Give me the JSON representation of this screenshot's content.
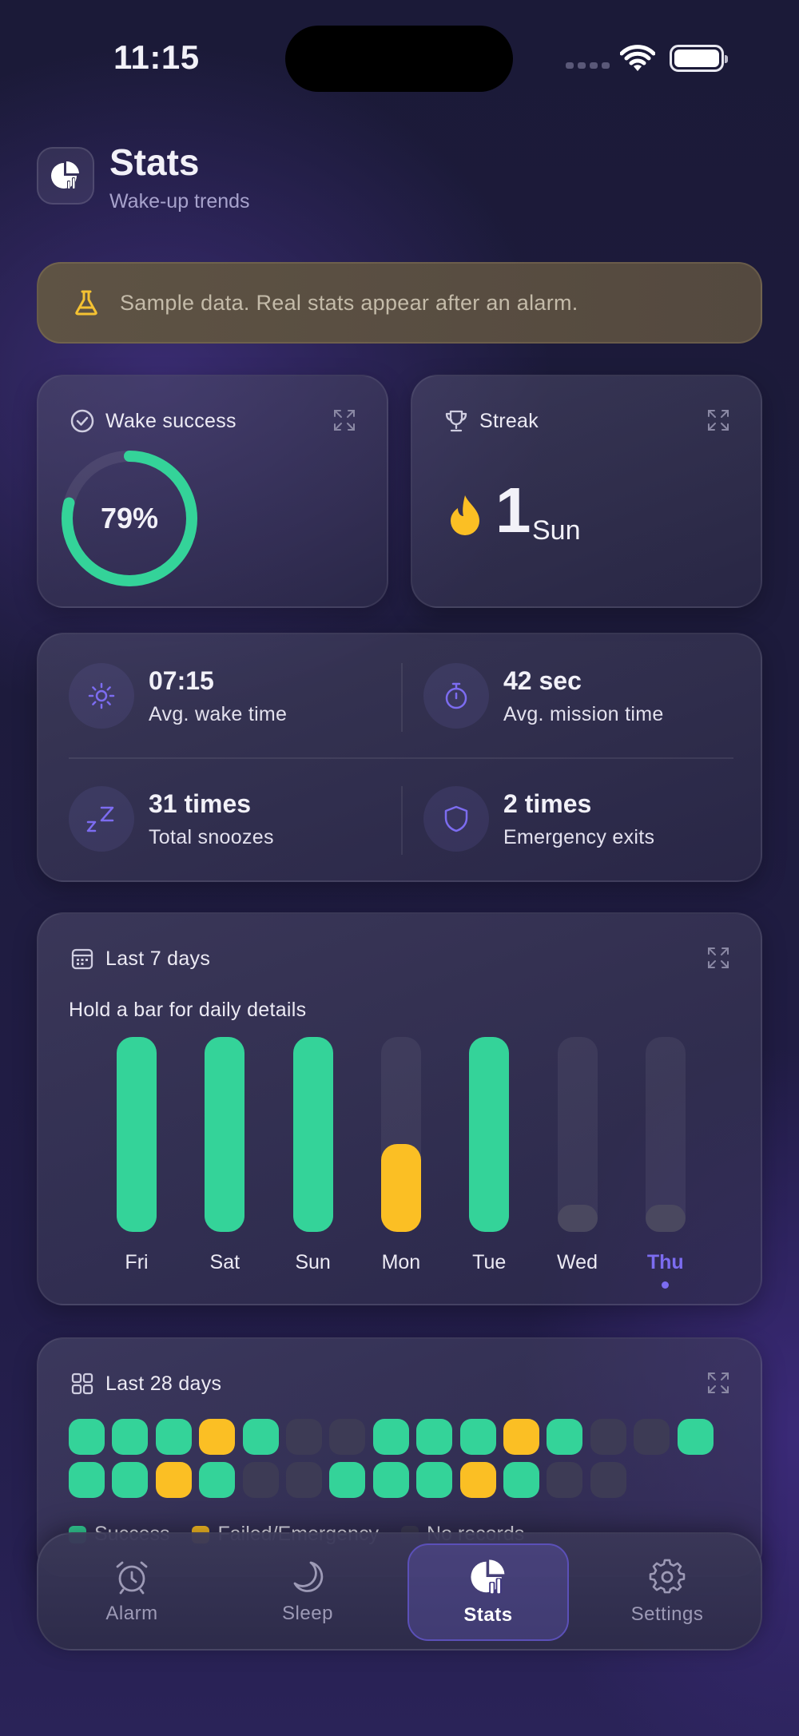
{
  "status": {
    "time": "11:15"
  },
  "header": {
    "title": "Stats",
    "subtitle": "Wake-up trends"
  },
  "banner": {
    "text": "Sample data. Real stats appear after an alarm."
  },
  "wake_success": {
    "title": "Wake success",
    "value": "79%",
    "fraction": 0.79
  },
  "streak": {
    "title": "Streak",
    "value": "1",
    "unit": "Sun"
  },
  "stats": {
    "avg_wake": {
      "value": "07:15",
      "label": "Avg. wake time"
    },
    "avg_mission": {
      "value": "42 sec",
      "label": "Avg. mission time"
    },
    "snoozes": {
      "value": "31 times",
      "label": "Total snoozes"
    },
    "emergency": {
      "value": "2 times",
      "label": "Emergency exits"
    }
  },
  "last7": {
    "title": "Last 7 days",
    "hint": "Hold a bar for daily details",
    "days": [
      {
        "label": "Fri",
        "fraction": 1.0,
        "status": "success"
      },
      {
        "label": "Sat",
        "fraction": 1.0,
        "status": "success"
      },
      {
        "label": "Sun",
        "fraction": 1.0,
        "status": "success"
      },
      {
        "label": "Mon",
        "fraction": 0.45,
        "status": "failed"
      },
      {
        "label": "Tue",
        "fraction": 1.0,
        "status": "success"
      },
      {
        "label": "Wed",
        "fraction": 0.14,
        "status": "none"
      },
      {
        "label": "Thu",
        "fraction": 0.14,
        "status": "none",
        "today": true
      }
    ]
  },
  "last28": {
    "title": "Last 28 days",
    "row1": [
      "success",
      "success",
      "success",
      "failed",
      "success",
      "none",
      "none",
      "success",
      "success",
      "success",
      "failed",
      "success",
      "none",
      "none",
      "success"
    ],
    "row2": [
      "success",
      "success",
      "failed",
      "success",
      "none",
      "none",
      "success",
      "success",
      "success",
      "failed",
      "success",
      "none",
      "none"
    ],
    "legend": {
      "success": "Success",
      "failed": "Failed/Emergency",
      "none": "No records"
    }
  },
  "nav": {
    "alarm": "Alarm",
    "sleep": "Sleep",
    "stats": "Stats",
    "settings": "Settings"
  },
  "colors": {
    "success": "#34d399",
    "failed": "#fbbf24",
    "none": "#3d3b55",
    "accent": "#7c6cf0"
  }
}
